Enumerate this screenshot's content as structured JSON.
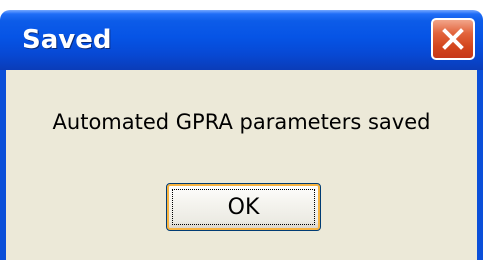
{
  "window": {
    "title": "Saved",
    "close_icon": "close-icon"
  },
  "dialog": {
    "message": "Automated GPRA parameters saved",
    "ok_label": "OK"
  },
  "colors": {
    "titlebar": "#0654e6",
    "body": "#ece9d8",
    "close_button": "#d3461d",
    "focus_ring": "#f8b33f"
  }
}
